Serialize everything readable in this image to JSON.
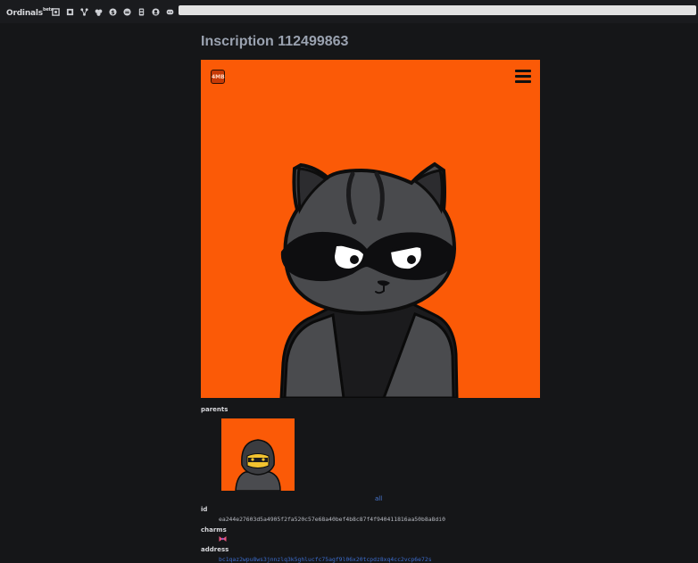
{
  "header": {
    "brand": "Ordinals",
    "brand_tag": "beta",
    "nav_icons": [
      "blocks-icon",
      "rune-icon",
      "graph-icon",
      "clock-icon",
      "cycle-icon",
      "satoshi-icon",
      "wallet-icon",
      "github-icon",
      "discord-icon"
    ],
    "search_value": ""
  },
  "main": {
    "title": "Inscription 112499863",
    "preview": {
      "background": "#fb5a07",
      "badge_text": "4MB"
    },
    "parents_label": "parents",
    "parent_link": "all",
    "id_label": "id",
    "id_value": "ea244e27603d5a4905f2fa520c57e68a40bef4b8c87f4f940411816aa50b8a8di0",
    "charms_label": "charms",
    "charm_icon": "ribbon-icon",
    "address_label": "address",
    "address_value": "bc1qaz2wpu8ws3jnnzlq3k5ghlucfc75agf9l06x20tcpdz8xq4cc2vcp6e72s"
  }
}
